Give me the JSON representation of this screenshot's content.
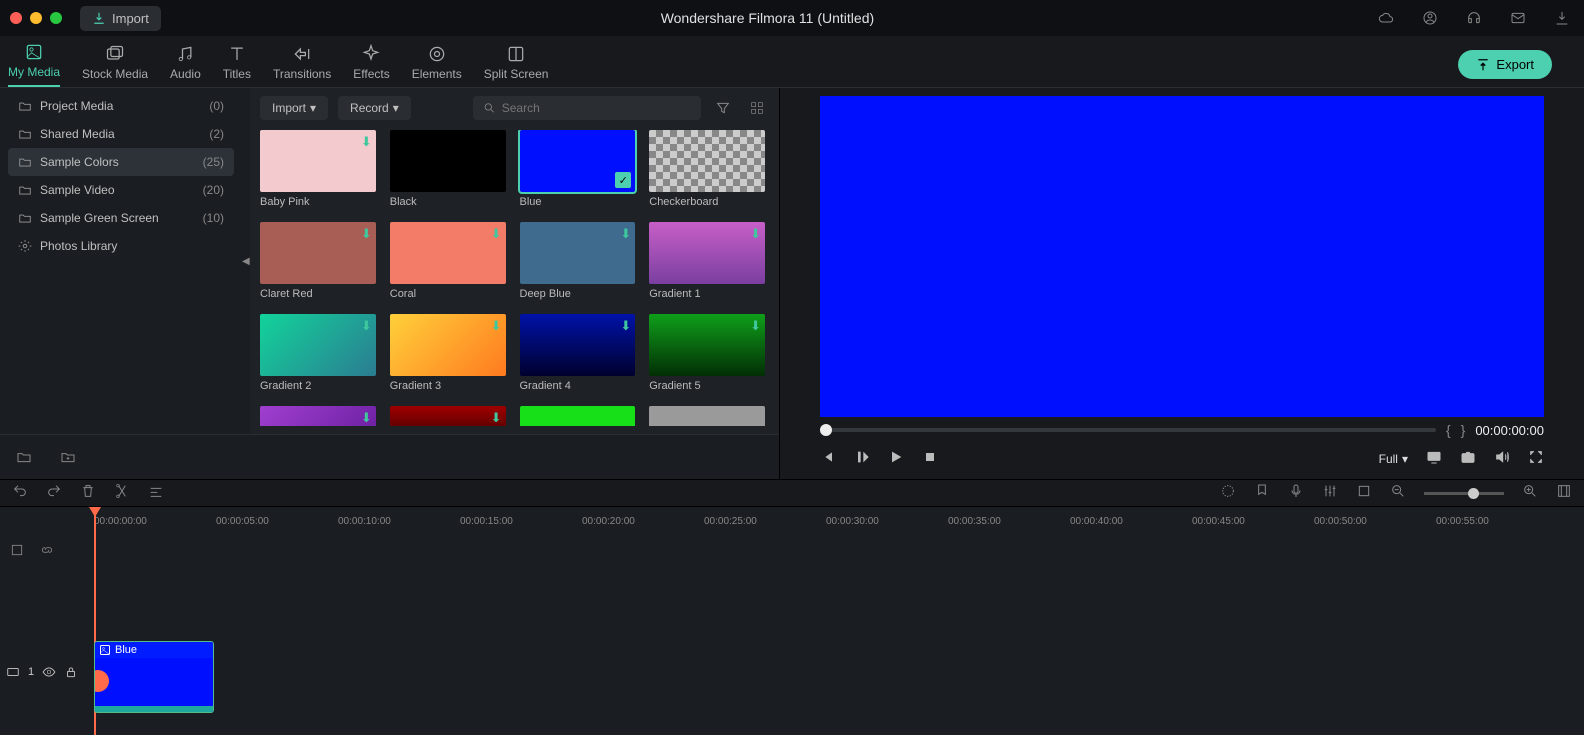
{
  "titlebar": {
    "import_label": "Import",
    "title": "Wondershare Filmora 11 (Untitled)"
  },
  "tabs": [
    {
      "label": "My Media",
      "active": true
    },
    {
      "label": "Stock Media"
    },
    {
      "label": "Audio"
    },
    {
      "label": "Titles"
    },
    {
      "label": "Transitions"
    },
    {
      "label": "Effects"
    },
    {
      "label": "Elements"
    },
    {
      "label": "Split Screen"
    }
  ],
  "export_label": "Export",
  "sidebar": {
    "items": [
      {
        "label": "Project Media",
        "count": "(0)"
      },
      {
        "label": "Shared Media",
        "count": "(2)"
      },
      {
        "label": "Sample Colors",
        "count": "(25)",
        "active": true
      },
      {
        "label": "Sample Video",
        "count": "(20)"
      },
      {
        "label": "Sample Green Screen",
        "count": "(10)"
      },
      {
        "label": "Photos Library",
        "gear": true
      }
    ]
  },
  "grid_toolbar": {
    "import_label": "Import",
    "record_label": "Record",
    "search_placeholder": "Search"
  },
  "swatches": [
    {
      "label": "Baby Pink",
      "style": "background:#f3cace",
      "dl": true
    },
    {
      "label": "Black",
      "style": "background:#000000"
    },
    {
      "label": "Blue",
      "style": "background:#0010ff",
      "selected": true
    },
    {
      "label": "Checkerboard",
      "checker": true
    },
    {
      "label": "Claret Red",
      "style": "background:#a95e55",
      "dl": true
    },
    {
      "label": "Coral",
      "style": "background:#f27c68",
      "dl": true
    },
    {
      "label": "Deep Blue",
      "style": "background:#3f6b8f",
      "dl": true
    },
    {
      "label": "Gradient 1",
      "style": "background:linear-gradient(180deg,#c75fc7,#7a3fa0)",
      "dl": true
    },
    {
      "label": "Gradient 2",
      "style": "background:linear-gradient(135deg,#12d39a,#2b7c92)",
      "dl": true
    },
    {
      "label": "Gradient 3",
      "style": "background:linear-gradient(135deg,#ffd03a,#ff7a1f)",
      "dl": true
    },
    {
      "label": "Gradient 4",
      "style": "background:linear-gradient(180deg,#0012a8,#00002e)",
      "dl": true
    },
    {
      "label": "Gradient 5",
      "style": "background:linear-gradient(180deg,#0f9f1a,#022e05)",
      "dl": true
    },
    {
      "label": "",
      "style": "background:linear-gradient(135deg,#a03fd0,#6a1fa0)",
      "dl": true,
      "partial": true
    },
    {
      "label": "",
      "style": "background:linear-gradient(180deg,#a00000,#3a0000)",
      "dl": true,
      "partial": true
    },
    {
      "label": "",
      "style": "background:#18e018",
      "partial": true
    },
    {
      "label": "",
      "style": "background:#9a9a9a",
      "partial": true
    }
  ],
  "preview": {
    "timecode": "00:00:00:00",
    "quality": "Full"
  },
  "ruler_marks": [
    "00:00:00:00",
    "00:00:05:00",
    "00:00:10:00",
    "00:00:15:00",
    "00:00:20:00",
    "00:00:25:00",
    "00:00:30:00",
    "00:00:35:00",
    "00:00:40:00",
    "00:00:45:00",
    "00:00:50:00",
    "00:00:55:00"
  ],
  "track": {
    "index": "1"
  },
  "clip": {
    "label": "Blue"
  }
}
